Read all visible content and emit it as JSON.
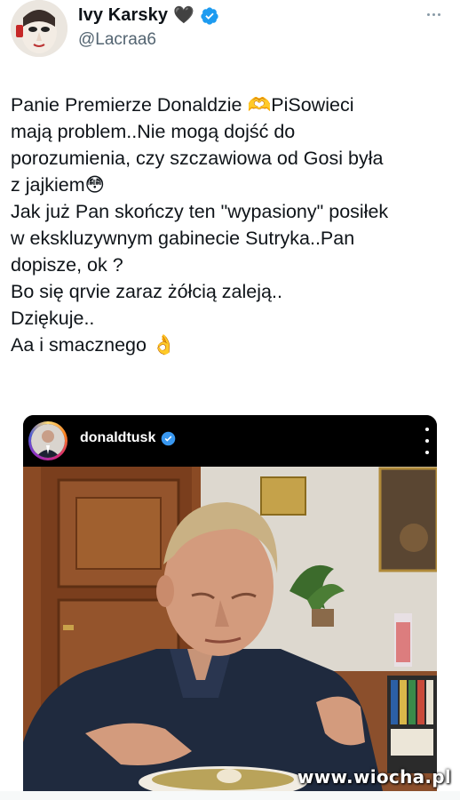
{
  "author": {
    "display_name": "Ivy Karsky",
    "heart_emoji": "🖤",
    "handle": "@Lacraa6",
    "verified_icon": "verified-badge-icon",
    "verified_color": "#1d9bf0"
  },
  "tweet": {
    "lines": [
      "Panie Premierze Donaldzie 🫶PiSowieci",
      "mają problem..Nie mogą dojść do",
      "porozumienia, czy szczawiowa od Gosi była",
      "z jajkiem😳",
      "Jak już Pan skończy ten \"wypasiony\" posiłek",
      "w ekskluzywnym gabinecie Sutryka..Pan",
      "dopisze, ok ?",
      "Bo się qrvie zaraz żółcią zaleją..",
      "Dziękuje..",
      "Aa i smacznego 👌"
    ]
  },
  "embedded_post": {
    "username": "donaldtusk",
    "verified_color": "#3897f0"
  },
  "watermark": "www.wiocha.pl"
}
